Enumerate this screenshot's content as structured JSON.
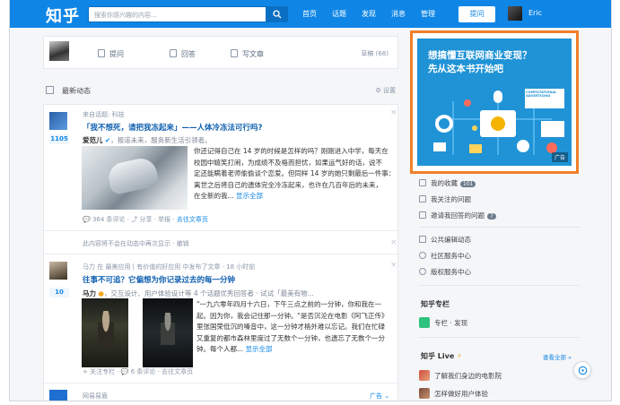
{
  "header": {
    "logo": "知乎",
    "search_placeholder": "搜索你感兴趣的内容...",
    "nav": [
      "首页",
      "话题",
      "发现",
      "消息",
      "管理"
    ],
    "ask_button": "提问",
    "username": "Eric"
  },
  "action_bar": {
    "ask": "提问",
    "answer": "回答",
    "write": "写文章",
    "drafts": "草稿 (68)"
  },
  "feed_header": {
    "title": "最新动态",
    "settings": "设置"
  },
  "feed": {
    "item1": {
      "source": "来自话题: 科技",
      "title": "「我不想死，请把我冻起来」——人体冷冻法可行吗?",
      "votes": "1105",
      "author": "爱范儿",
      "author_desc": "，报道未来，服务新生活引领者。",
      "body": [
        "你还记得自己在 14 岁的时候是怎样的吗？刚刚进入中学，每天在",
        "校园中嬉笑打闹，为成绩不及格而担忧，如果运气好的话，说不",
        "定还能瞒着老师偷偷谈个恋爱。但同样 14 岁的她只剩最后一件事：",
        "离世之后将自己的遗体完全冷冻起来，也许在几百年后的未来，",
        "在全新的我..."
      ],
      "read_more": "显示全部",
      "comments": "364 条评论",
      "share": "分享",
      "report": "举报",
      "view": "去往文章页"
    },
    "hidden_notice": {
      "text": "此内容将不会在动态中再次显示",
      "undo": "撤销"
    },
    "item2": {
      "source": "马力 在 最美应用 | 有价值的好应用 中发布了文章 · 18 小时前",
      "title": "往事不可追？它偏想为你记录过去的每一分钟",
      "votes": "10",
      "author": "马力",
      "author_desc": "，交互设计、用户体验设计等 4 个话题优秀回答者 · 试试「最美有物...",
      "body": [
        "\"一九六零年四月十六日，下午三点之前的一分钟，你和我在一",
        "起。因为你，我会记住那一分钟。\"是否沉沦在电影《阿飞正传》",
        "里张国荣低沉的嗓音中，这一分钟才格外难以忘记。我们在忙碌",
        "又重复的都市森林里度过了无数个一分钟，也遗忘了无数个一分",
        "钟。每个人都..."
      ],
      "read_more": "显示全部",
      "follow": "关注专栏",
      "comments": "6 条评论",
      "view": "去往文章页"
    },
    "item3": {
      "source": "网易易盾",
      "ad_label": "广告"
    }
  },
  "ad": {
    "title_line1": "想搞懂互联网商业变现？",
    "title_line2": "先从这本书开始吧",
    "book_text": "COMPUTATIONAL ADVERTISING",
    "tag": "广告",
    "color": "#1f93d6",
    "border_color": "#f07f2a"
  },
  "sidebar": {
    "collections": "我的收藏",
    "collections_count": "101",
    "followed_questions": "我关注的问题",
    "invites": "邀请我回答的问题",
    "invites_count": "7",
    "public_edit": "公共编辑动态",
    "community": "社区服务中心",
    "copyright": "版权服务中心",
    "column_header": "知乎专栏",
    "column_item": "专栏 · 发现",
    "live_header": "知乎 Live",
    "live_all": "查看全部 »",
    "live_items": [
      "了解我们身边的电影院",
      "怎样做好用户体验"
    ]
  }
}
